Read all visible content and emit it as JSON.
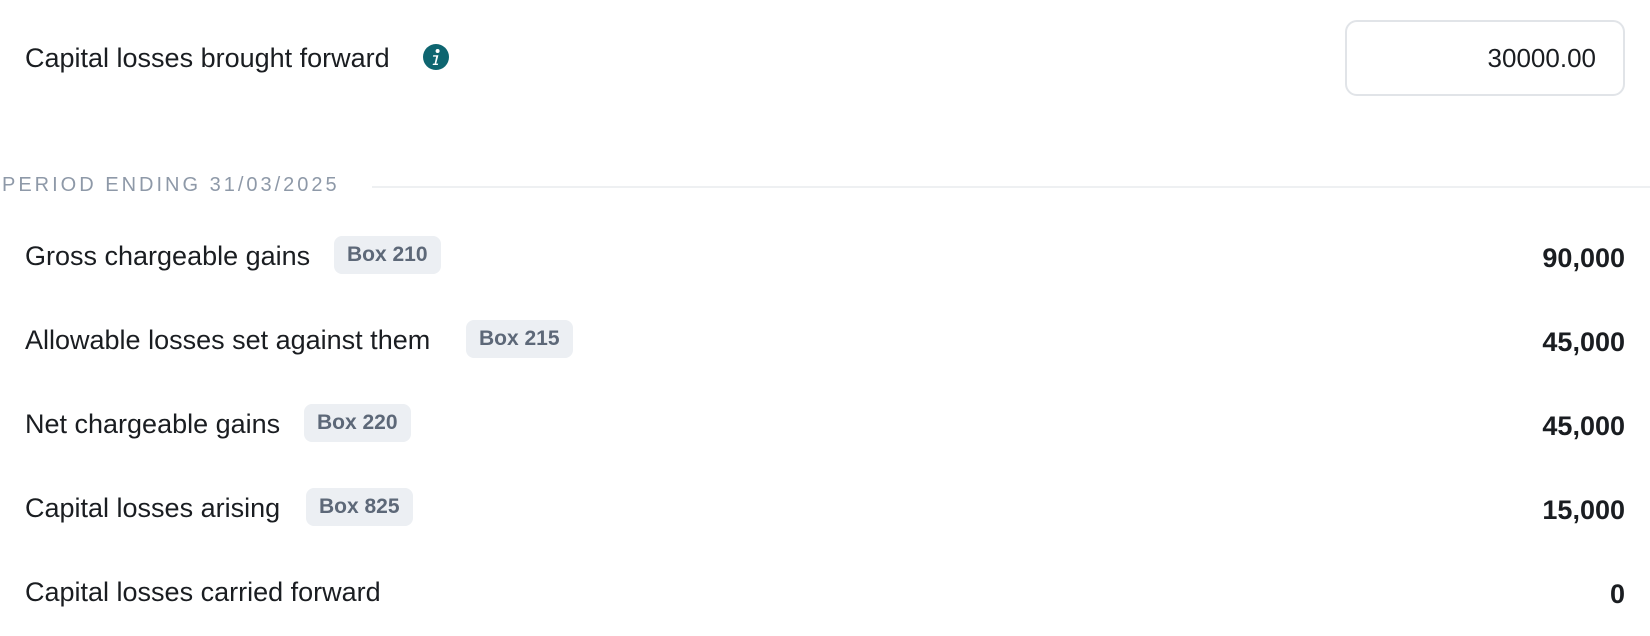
{
  "capital_losses_bf": {
    "label": "Capital losses brought forward",
    "info_icon": "info-circle-icon",
    "value": "30000.00"
  },
  "period": {
    "title": "PERIOD ENDING 31/03/2025"
  },
  "rows": [
    {
      "label": "Gross chargeable gains",
      "box": "Box 210",
      "value": "90,000"
    },
    {
      "label": "Allowable losses set against them",
      "box": "Box 215",
      "value": "45,000"
    },
    {
      "label": "Net chargeable gains",
      "box": "Box 220",
      "value": "45,000"
    },
    {
      "label": "Capital losses arising",
      "box": "Box 825",
      "value": "15,000"
    },
    {
      "label": "Capital losses carried forward",
      "value": "0"
    }
  ],
  "colors": {
    "info_icon": "#0e6570",
    "badge_bg": "#eceff3",
    "badge_text": "#5d6878",
    "section_title": "#8e99a8"
  }
}
